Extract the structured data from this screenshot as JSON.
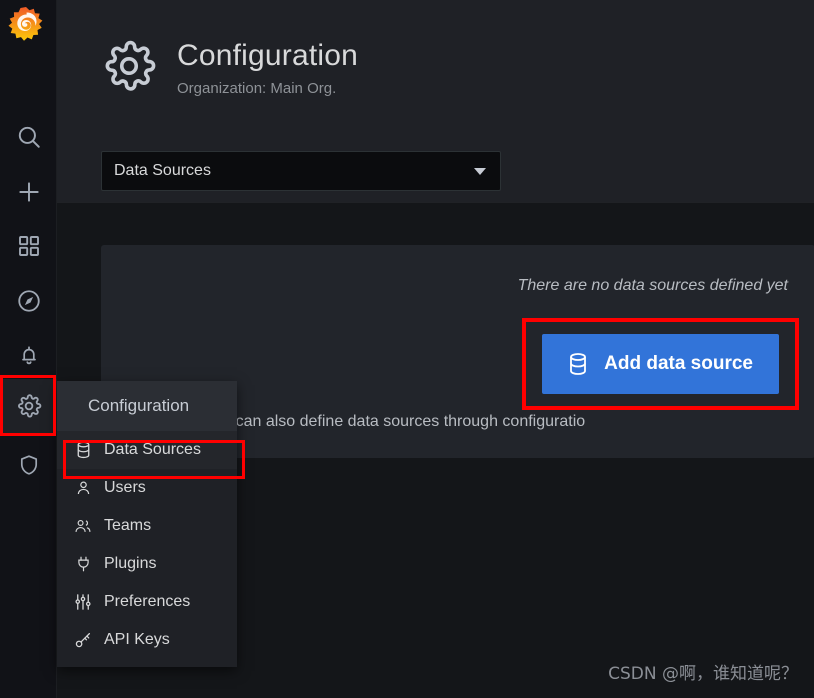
{
  "nav_rail": {
    "logo": "grafana-logo",
    "items": [
      {
        "icon": "search-icon",
        "name": "search"
      },
      {
        "icon": "plus-icon",
        "name": "create"
      },
      {
        "icon": "dashboards-icon",
        "name": "dashboards"
      },
      {
        "icon": "compass-icon",
        "name": "explore"
      },
      {
        "icon": "bell-icon",
        "name": "alerting"
      },
      {
        "icon": "gear-icon",
        "name": "configuration"
      },
      {
        "icon": "shield-icon",
        "name": "server-admin"
      }
    ]
  },
  "header": {
    "icon": "gear-icon",
    "title": "Configuration",
    "subtitle": "Organization: Main Org."
  },
  "dropdown": {
    "selected": "Data Sources",
    "caret": "chevron-down-icon"
  },
  "panel": {
    "empty_message": "There are no data sources defined yet",
    "add_button": {
      "label": "Add data source",
      "icon": "database-icon",
      "color": "#3274d9"
    },
    "protip": {
      "icon": "rocket-icon",
      "text": "ProTip: You can also define data sources through configuratio"
    }
  },
  "flyout_menu": {
    "header": "Configuration",
    "items": [
      {
        "label": "Data Sources",
        "icon": "database-icon",
        "highlighted": true
      },
      {
        "label": "Users",
        "icon": "user-icon",
        "highlighted": false
      },
      {
        "label": "Teams",
        "icon": "users-icon",
        "highlighted": false
      },
      {
        "label": "Plugins",
        "icon": "plug-icon",
        "highlighted": false
      },
      {
        "label": "Preferences",
        "icon": "sliders-icon",
        "highlighted": false
      },
      {
        "label": "API Keys",
        "icon": "key-icon",
        "highlighted": false
      }
    ]
  },
  "annotations": {
    "highlight_color": "#ff0000",
    "boxes": [
      "sidebar-gear",
      "menu-data-sources",
      "add-data-source-button"
    ]
  },
  "watermark": "CSDN @啊，谁知道呢？"
}
